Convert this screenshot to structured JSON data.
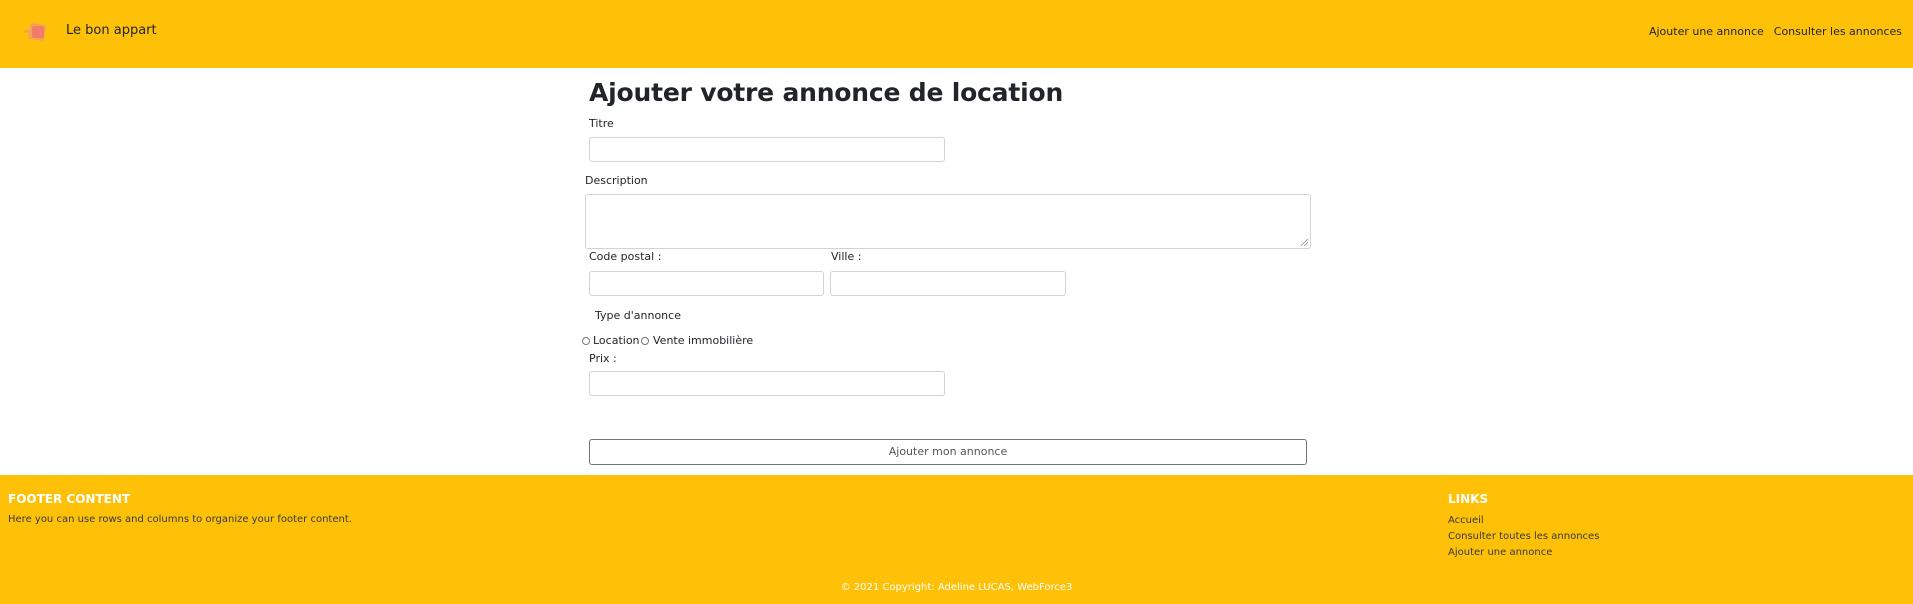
{
  "colors": {
    "accent": "#ffc107",
    "text": "#212529"
  },
  "header": {
    "brand_name": "Le bon appart",
    "logo_icon": "brand-logo-icon",
    "nav": [
      "Ajouter une annonce",
      "Consulter les annonces"
    ]
  },
  "form": {
    "title": "Ajouter votre annonce de location",
    "titre_label": "Titre",
    "titre_value": "",
    "description_label": "Description",
    "description_value": "",
    "code_postal_label": "Code postal :",
    "code_postal_value": "",
    "ville_label": "Ville :",
    "ville_value": "",
    "type_label": "Type d'annonce",
    "type_options": [
      "Location",
      "Vente immobilière"
    ],
    "prix_label": "Prix :",
    "prix_value": "",
    "submit_label": "Ajouter mon annonce"
  },
  "footer": {
    "content_title": "FOOTER CONTENT",
    "content_text": "Here you can use rows and columns to organize your footer content.",
    "links_title": "LINKS",
    "links": [
      "Accueil",
      "Consulter toutes les annonces",
      "Ajouter une annonce"
    ],
    "copyright": "© 2021 Copyright: Adeline LUCAS, WebForce3"
  }
}
